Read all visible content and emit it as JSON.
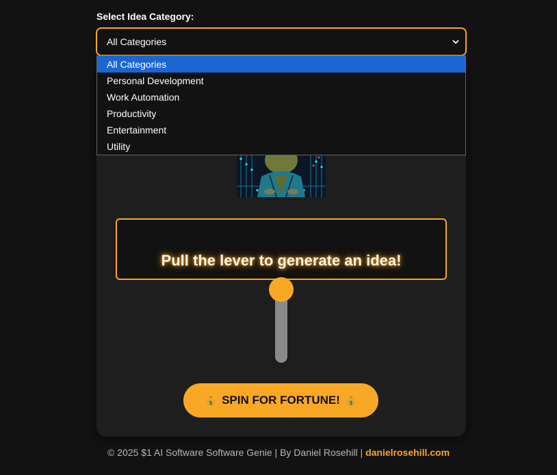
{
  "category": {
    "label": "Select Idea Category:",
    "selected": "All Categories",
    "options": [
      "All Categories",
      "Personal Development",
      "Work Automation",
      "Productivity",
      "Entertainment",
      "Utility"
    ]
  },
  "mascot": {
    "icon": "robot-mascot-image"
  },
  "idea": {
    "text": "Pull the lever to generate an idea!"
  },
  "lever": {
    "position": 0
  },
  "spin": {
    "label": "SPIN FOR FORTUNE!",
    "icon": "moneybag-icon"
  },
  "footer": {
    "text": "© 2025 $1 AI Software Software Genie | By Daniel Rosehill | ",
    "link": "danielrosehill.com"
  },
  "colors": {
    "accent": "#f9a825",
    "background": "#121212",
    "card": "#1e1e1e",
    "selected_option": "#1a66d2",
    "lever_track": "#8a8a8a"
  }
}
